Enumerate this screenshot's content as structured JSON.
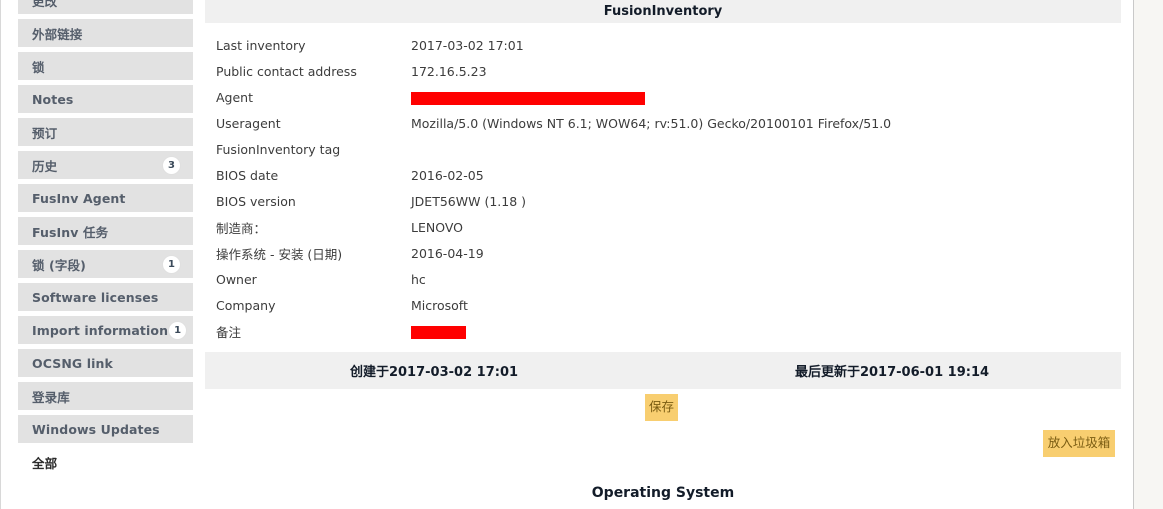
{
  "sidebar": {
    "items": [
      {
        "label": "更改",
        "badge": null,
        "style": "block"
      },
      {
        "label": "外部链接",
        "badge": null,
        "style": "block"
      },
      {
        "label": "锁",
        "badge": null,
        "style": "block"
      },
      {
        "label": "Notes",
        "badge": null,
        "style": "block"
      },
      {
        "label": "预订",
        "badge": null,
        "style": "block"
      },
      {
        "label": "历史",
        "badge": "3",
        "style": "block"
      },
      {
        "label": "FusInv Agent",
        "badge": null,
        "style": "block"
      },
      {
        "label": "FusInv 任务",
        "badge": null,
        "style": "block"
      },
      {
        "label": "锁 (字段)",
        "badge": "1",
        "style": "block"
      },
      {
        "label": "Software licenses",
        "badge": null,
        "style": "block"
      },
      {
        "label": "Import information",
        "badge": "1",
        "style": "block"
      },
      {
        "label": "OCSNG link",
        "badge": null,
        "style": "block"
      },
      {
        "label": "登录库",
        "badge": null,
        "style": "block"
      },
      {
        "label": "Windows Updates",
        "badge": null,
        "style": "block"
      },
      {
        "label": "全部",
        "badge": null,
        "style": "plain"
      }
    ]
  },
  "main": {
    "panel_title": "FusionInventory",
    "fields": [
      {
        "label": "Last inventory",
        "value": "2017-03-02 17:01",
        "redacted": null
      },
      {
        "label": "Public contact address",
        "value": "172.16.5.23",
        "redacted": null
      },
      {
        "label": "Agent",
        "value": "",
        "redacted": "wide"
      },
      {
        "label": "Useragent",
        "value": "Mozilla/5.0 (Windows NT 6.1; WOW64; rv:51.0) Gecko/20100101 Firefox/51.0",
        "redacted": null
      },
      {
        "label": "FusionInventory tag",
        "value": "",
        "redacted": null
      },
      {
        "label": "BIOS date",
        "value": "2016-02-05",
        "redacted": null
      },
      {
        "label": "BIOS version",
        "value": "JDET56WW (1.18 )",
        "redacted": null
      },
      {
        "label": "制造商：",
        "value": "LENOVO",
        "redacted": null
      },
      {
        "label": "操作系统 - 安装 (日期)",
        "value": "2016-04-19",
        "redacted": null
      },
      {
        "label": "Owner",
        "value": "hc",
        "redacted": null
      },
      {
        "label": "Company",
        "value": "Microsoft",
        "redacted": null
      },
      {
        "label": "备注",
        "value": "",
        "redacted": "narrow"
      }
    ],
    "footer": {
      "created": "创建于2017-03-02 17:01",
      "updated": "最后更新于2017-06-01 19:14"
    },
    "save_label": "保存",
    "trash_label": "放入垃圾箱",
    "os_heading": "Operating System"
  },
  "colors": {
    "accent_button": "#f8ce70",
    "panel_header_bg": "#f0f0f0",
    "sidebar_item_bg": "#e2e2e2",
    "redaction": "#ff0000"
  }
}
